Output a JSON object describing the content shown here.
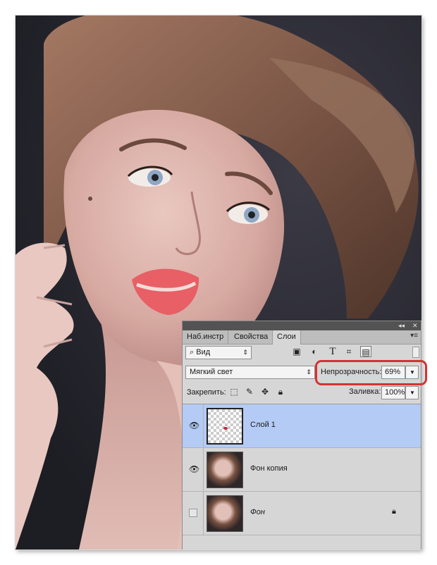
{
  "panel": {
    "tabs": [
      "Наб.инстр",
      "Свойства",
      "Слои"
    ],
    "active_tab": "Слои",
    "collapse_icon": "collapse-arrows-icon",
    "close_icon": "close-icon",
    "menu_icon": "panel-menu-icon",
    "filter": {
      "label": "Вид",
      "icon": "search-icon"
    },
    "filter_icons": [
      "image-filter-icon",
      "adjustment-filter-icon",
      "type-filter-icon",
      "shape-filter-icon",
      "smart-object-filter-icon"
    ],
    "blend_mode": "Мягкий свет",
    "opacity_label": "Непрозрачность:",
    "opacity_value": "69%",
    "lock_label": "Закрепить:",
    "lock_icons": [
      "lock-pixels-icon",
      "lock-brush-icon",
      "lock-position-icon",
      "lock-all-icon"
    ],
    "fill_label": "Заливка:",
    "fill_value": "100%",
    "highlight_color": "#d63232",
    "selected_color": "#b4cbf6"
  },
  "layers": [
    {
      "name": "Слой 1",
      "visible": true,
      "selected": true,
      "thumb": "transparent-with-red-dot"
    },
    {
      "name": "Фон копия",
      "visible": true,
      "selected": false,
      "thumb": "portrait"
    },
    {
      "name": "Фон",
      "visible": false,
      "selected": false,
      "locked": true,
      "italic": true,
      "thumb": "portrait"
    }
  ]
}
